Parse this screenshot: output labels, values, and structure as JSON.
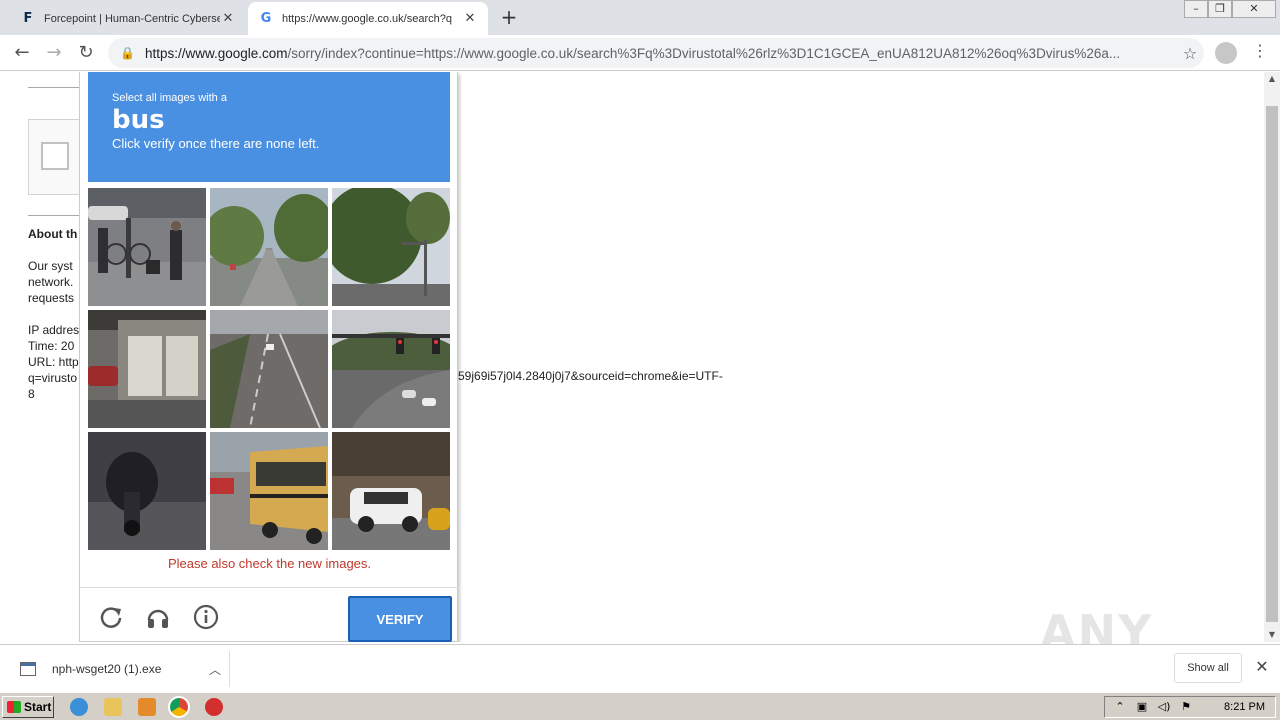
{
  "browser": {
    "tabs": [
      {
        "title": "Forcepoint | Human-Centric Cyberse",
        "favicon": "F",
        "active": false
      },
      {
        "title": "https://www.google.co.uk/search?q",
        "favicon": "G",
        "active": true
      }
    ],
    "url_host": "https://www.google.com",
    "url_rest": "/sorry/index?continue=https://www.google.co.uk/search%3Fq%3Dvirustotal%26rlz%3D1C1GCEA_enUA812UA812%26oq%3Dvirus%26a..."
  },
  "page": {
    "about_heading": "About th",
    "about_lines": [
      "Our syst",
      "network.",
      "requests"
    ],
    "ip_lines": [
      "IP addres",
      "Time: 20",
      "URL: http",
      "q=virusto",
      "8"
    ],
    "url_tail": "59j69i57j0l4.2840j0j7&sourceid=chrome&ie=UTF-"
  },
  "captcha": {
    "select_text": "Select all images with a",
    "target": "bus",
    "instruction": "Click verify once there are none left.",
    "error": "Please also check the new images.",
    "verify_label": "VERIFY",
    "accent": "#4a90e2",
    "tiles": [
      "street-pedestrians",
      "tree-lined-road",
      "trees-street-light",
      "garage",
      "highway",
      "intersection-traffic-lights",
      "motorcycle",
      "school-bus",
      "white-suv"
    ]
  },
  "downloads": {
    "file_name": "nph-wsget20 (1).exe",
    "show_all": "Show all"
  },
  "watermark": "ANY RUN",
  "taskbar": {
    "start_label": "Start",
    "clock": "8:21 PM"
  }
}
